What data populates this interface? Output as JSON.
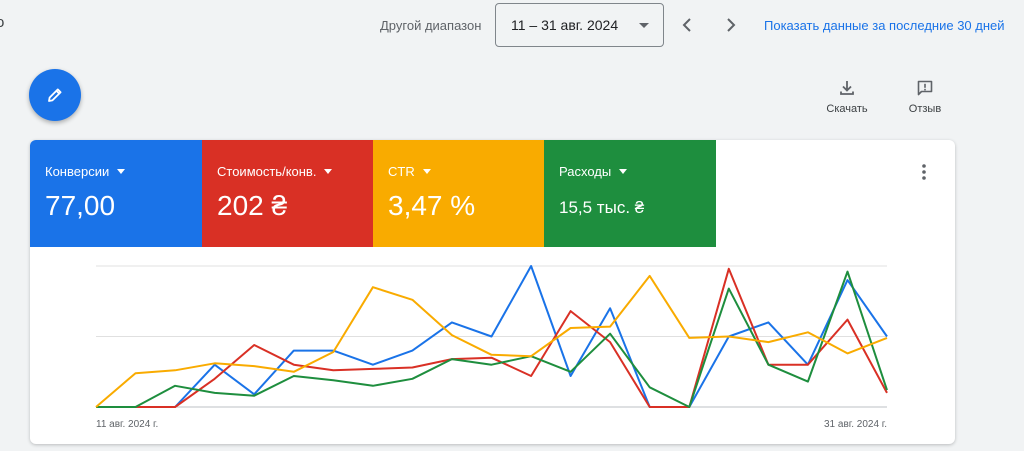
{
  "header": {
    "left_glyph": "о",
    "range_label": "Другой диапазон",
    "date_range": "11 – 31 авг. 2024",
    "show_last_30": "Показать данные за последние 30 дней"
  },
  "toolbar": {
    "download_label": "Скачать",
    "feedback_label": "Отзыв"
  },
  "metrics": [
    {
      "label": "Конверсии",
      "value": "77,00",
      "color": "#1a73e8"
    },
    {
      "label": "Стоимость/конв.",
      "value": "202 ₴",
      "color": "#d93025"
    },
    {
      "label": "CTR",
      "value": "3,47 %",
      "color": "#f9ab00"
    },
    {
      "label": "Расходы",
      "value": "15,5 тыс. ₴",
      "color": "#1e8e3e"
    }
  ],
  "chart_data": {
    "type": "line",
    "x_start_label": "11 авг. 2024 г.",
    "x_end_label": "31 авг. 2024 г.",
    "ylim": [
      0,
      1
    ],
    "grid": true,
    "series": [
      {
        "color": "#1a73e8",
        "values": [
          0,
          0,
          0,
          0.3,
          0.09,
          0.4,
          0.4,
          0.3,
          0.4,
          0.6,
          0.5,
          1.0,
          0.22,
          0.7,
          0,
          0,
          0.5,
          0.6,
          0.3,
          0.9,
          0.5
        ]
      },
      {
        "color": "#d93025",
        "values": [
          0,
          0,
          0,
          0.2,
          0.44,
          0.3,
          0.26,
          0.27,
          0.28,
          0.34,
          0.35,
          0.22,
          0.68,
          0.46,
          0,
          0,
          0.98,
          0.3,
          0.3,
          0.62,
          0.1
        ]
      },
      {
        "color": "#1e8e3e",
        "values": [
          0,
          0,
          0.15,
          0.1,
          0.08,
          0.22,
          0.19,
          0.15,
          0.2,
          0.34,
          0.3,
          0.36,
          0.25,
          0.52,
          0.14,
          0,
          0.84,
          0.3,
          0.18,
          0.96,
          0.12
        ]
      },
      {
        "color": "#f9ab00",
        "values": [
          0,
          0.24,
          0.26,
          0.31,
          0.29,
          0.25,
          0.39,
          0.85,
          0.76,
          0.51,
          0.37,
          0.36,
          0.56,
          0.57,
          0.93,
          0.49,
          0.5,
          0.46,
          0.53,
          0.38,
          0.49
        ]
      }
    ]
  }
}
